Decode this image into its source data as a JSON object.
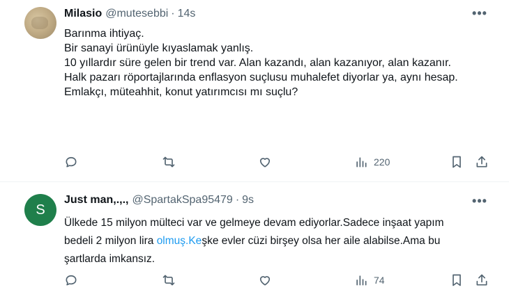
{
  "tweets": [
    {
      "display_name": "Milasio",
      "handle": "@mutesebbi",
      "separator": "·",
      "time": "14s",
      "more": "•••",
      "lines": [
        "Barınma ihtiyaç.",
        "Bir sanayi ürünüyle kıyaslamak yanlış.",
        "10 yıllardır süre gelen bir trend var. Alan kazandı, alan kazanıyor, alan kazanır.",
        "Halk pazarı röportajlarında enflasyon suçlusu muhalefet diyorlar ya, aynı hesap.",
        "Emlakçı, müteahhit, konut yatırımcısı mı suçlu?"
      ],
      "views": "220"
    },
    {
      "display_name": "Just man,.,.,",
      "handle": "@SpartakSpa95479",
      "separator": "·",
      "time": "9s",
      "avatar_letter": "S",
      "more": "•••",
      "text_before_link": "Ülkede 15 milyon mülteci var ve gelmeye devam ediyorlar.Sadece inşaat yapım bedeli 2 milyon lira ",
      "link_text": "olmuş.Ke",
      "text_after_link": "şke evler cüzi birşey olsa her aile alabilse.Ama bu şartlarda imkansız.",
      "views": "74"
    }
  ],
  "colors": {
    "text": "#0f1419",
    "secondary": "#536471",
    "link": "#1d9bf0",
    "divider": "#eff3f4",
    "avatar_s": "#1f7f4b"
  },
  "icons": [
    "reply-icon",
    "retweet-icon",
    "like-icon",
    "views-icon",
    "bookmark-icon",
    "share-icon",
    "more-icon"
  ]
}
